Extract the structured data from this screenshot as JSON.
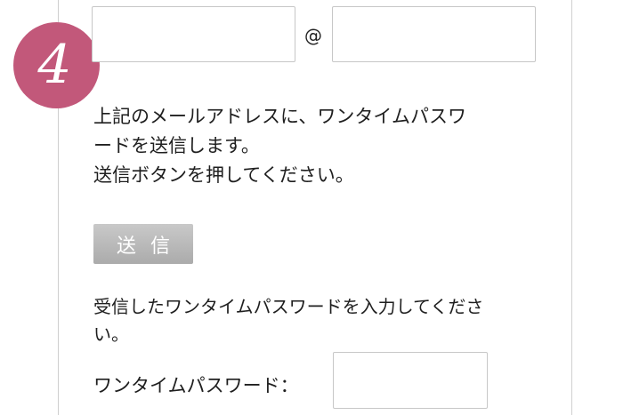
{
  "step": {
    "number": "4",
    "badge_color": "#c2587a"
  },
  "email": {
    "local_value": "",
    "at_symbol": "@",
    "domain_value": ""
  },
  "instruction": {
    "line1": "上記のメールアドレスに、ワンタイムパスワ",
    "line2": "ードを送信します。",
    "line3": "送信ボタンを押してください。"
  },
  "send_button": {
    "label": "送信"
  },
  "received": {
    "line1": "受信したワンタイムパスワードを入力してくださ",
    "line2": "い。"
  },
  "otp": {
    "label": "ワンタイムパスワード：",
    "value": ""
  }
}
